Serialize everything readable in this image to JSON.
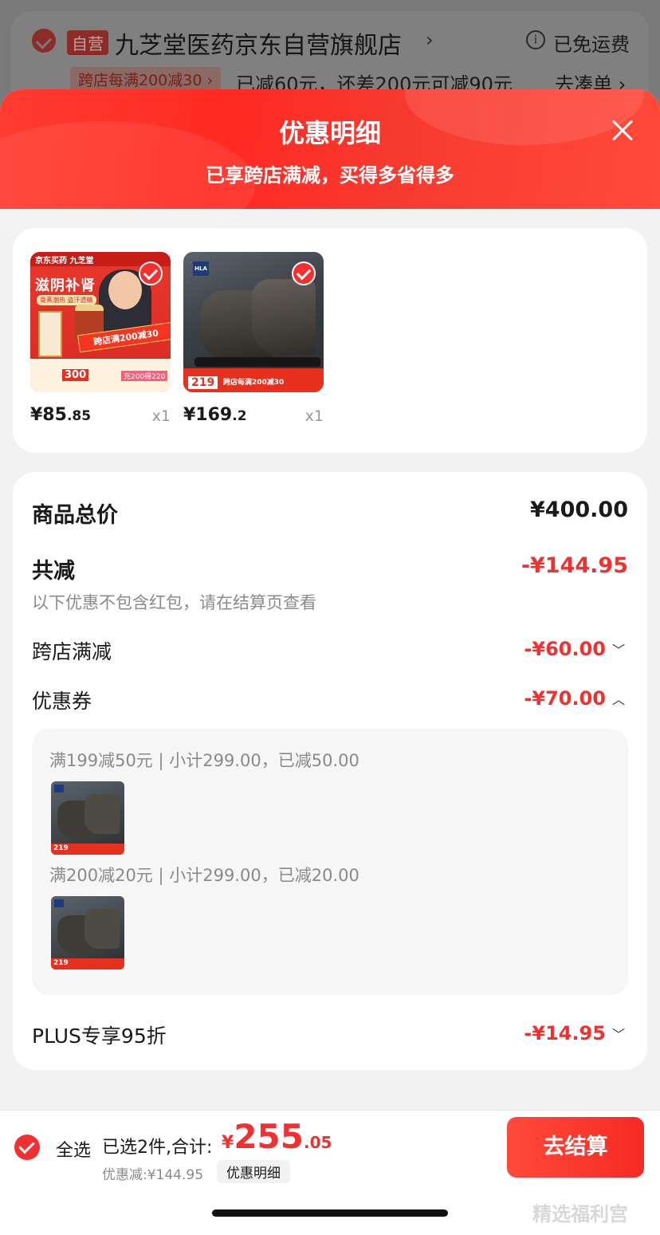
{
  "background": {
    "self_tag": "自营",
    "store_name": "九芝堂医药京东自营旗舰店",
    "store_arrow": "›",
    "info_icon": "ⓘ",
    "shipping": "已免运费",
    "promo_tag": "跨店每满200减30 ›",
    "promo_text": "已减60元，还差200元可减90元",
    "gather": "去凑单 ›"
  },
  "sheet": {
    "title": "优惠明细",
    "subtitle": "已享跨店满减，买得多省得多"
  },
  "products": [
    {
      "price_int": "¥85",
      "price_dec": ".85",
      "qty": "x1",
      "art": {
        "topbar": "京东买药  九芝堂",
        "headline": "滋阴补肾",
        "sub": "骨蒸潮热 盗汗遗精",
        "banner": "跨店满200减30",
        "tag300": "300",
        "tag200": "充200得220"
      }
    },
    {
      "price_int": "¥169",
      "price_dec": ".2",
      "qty": "x1",
      "art": {
        "logo": "HLA",
        "price_tag": "219",
        "strip": "跨店每满200减30"
      }
    }
  ],
  "summary": {
    "total_label": "商品总价",
    "total_value": "¥400.00",
    "reduce_label": "共减",
    "reduce_value": "-¥144.95",
    "hint": "以下优惠不包含红包，请在结算页查看",
    "cross_store_label": "跨店满减",
    "cross_store_value": "-¥60.00",
    "coupon_label": "优惠券",
    "coupon_value": "-¥70.00",
    "coupons": [
      {
        "text": "满199减50元 | 小计299.00，已减50.00",
        "thumb_tag": "219"
      },
      {
        "text": "满200减20元 | 小计299.00，已减20.00",
        "thumb_tag": "219"
      }
    ],
    "plus_label": "PLUS专享95折",
    "plus_value": "-¥14.95"
  },
  "bottom": {
    "select_all": "全选",
    "selected_count": "已选2件,合计:",
    "price_currency": "¥",
    "price_int": "255",
    "price_dec": ".05",
    "discount_line": "优惠减:¥144.95",
    "discount_detail": "优惠明细",
    "checkout": "去结算",
    "watermark": "精选福利宫"
  }
}
